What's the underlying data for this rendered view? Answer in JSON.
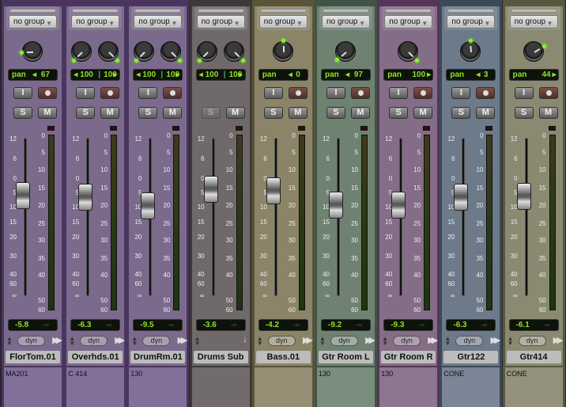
{
  "fader_scale": [
    "12",
    "6",
    "0",
    "5",
    "10",
    "15",
    "20",
    "30",
    "40",
    "60",
    "∞"
  ],
  "meter_scale": [
    "0",
    "5",
    "10",
    "15",
    "20",
    "25",
    "30",
    "35",
    "40",
    "50",
    "60"
  ],
  "volume_inf": "-∞",
  "channels": [
    {
      "name": "FlorTom.01",
      "group": "no group",
      "stereo": false,
      "pan_label": "pan",
      "pan": "67",
      "pan_dir": "left",
      "volume": "-5.8",
      "volume_db": -5.8,
      "comment": "MA201",
      "insert_label": "I",
      "solo": "S",
      "mute": "M",
      "dyn": "dyn",
      "color": "#7b6a8c",
      "border": "#4a3560",
      "comment_bg": "#82709a",
      "solo_disabled": false,
      "auxtype": false
    },
    {
      "name": "Overhds.01",
      "group": "no group",
      "stereo": true,
      "pan_l": "100",
      "pan_r": "100",
      "volume": "-6.3",
      "volume_db": -6.3,
      "comment": "C 414",
      "insert_label": "I",
      "solo": "S",
      "mute": "M",
      "dyn": "dyn",
      "color": "#7b6a8c",
      "border": "#4a3560",
      "comment_bg": "#82709a",
      "solo_disabled": false,
      "auxtype": false
    },
    {
      "name": "DrumRm.01",
      "group": "no group",
      "stereo": true,
      "pan_l": "100",
      "pan_r": "100",
      "volume": "-9.5",
      "volume_db": -9.5,
      "comment": "130",
      "insert_label": "I",
      "solo": "S",
      "mute": "M",
      "dyn": "dyn",
      "color": "#7b6a8c",
      "border": "#4a3560",
      "comment_bg": "#82709a",
      "solo_disabled": false,
      "auxtype": false
    },
    {
      "name": "Drums Sub",
      "group": "no group",
      "stereo": true,
      "pan_l": "100",
      "pan_r": "100",
      "volume": "-3.6",
      "volume_db": -3.6,
      "comment": "",
      "solo": "S",
      "mute": "M",
      "color": "#6f6a69",
      "border": "#3e3838",
      "comment_bg": "#716b6c",
      "solo_disabled": true,
      "auxtype": true
    },
    {
      "name": "Bass.01",
      "group": "no group",
      "stereo": false,
      "pan_label": "pan",
      "pan": "0",
      "pan_dir": "center",
      "volume": "-4.2",
      "volume_db": -4.2,
      "comment": "",
      "insert_label": "I",
      "solo": "S",
      "mute": "M",
      "dyn": "dyn",
      "color": "#8b8468",
      "border": "#5a5438",
      "comment_bg": "#958e74",
      "solo_disabled": false,
      "auxtype": false
    },
    {
      "name": "Gtr Room L",
      "group": "no group",
      "stereo": false,
      "pan_label": "pan",
      "pan": "97",
      "pan_dir": "left",
      "volume": "-9.2",
      "volume_db": -9.2,
      "comment": "130",
      "insert_label": "I",
      "solo": "S",
      "mute": "M",
      "dyn": "dyn",
      "color": "#6f8272",
      "border": "#3f5444",
      "comment_bg": "#7a8e7e",
      "solo_disabled": false,
      "auxtype": false
    },
    {
      "name": "Gtr Room R",
      "group": "no group",
      "stereo": false,
      "pan_label": "pan",
      "pan": "100",
      "pan_dir": "right",
      "volume": "-9.3",
      "volume_db": -9.3,
      "comment": "130",
      "insert_label": "I",
      "solo": "S",
      "mute": "M",
      "dyn": "dyn",
      "color": "#846d86",
      "border": "#553658",
      "comment_bg": "#8d7690",
      "solo_disabled": false,
      "auxtype": false
    },
    {
      "name": "Gtr122",
      "group": "no group",
      "stereo": false,
      "pan_label": "pan",
      "pan": "3",
      "pan_dir": "left",
      "volume": "-6.3",
      "volume_db": -6.3,
      "comment": "CONE",
      "insert_label": "I",
      "solo": "S",
      "mute": "M",
      "dyn": "dyn",
      "color": "#6c7a89",
      "border": "#3c4858",
      "comment_bg": "#7a8696",
      "solo_disabled": false,
      "auxtype": false
    },
    {
      "name": "Gtr414",
      "group": "no group",
      "stereo": false,
      "pan_label": "pan",
      "pan": "44",
      "pan_dir": "right",
      "volume": "-6.1",
      "volume_db": -6.1,
      "comment": "CONE",
      "insert_label": "I",
      "solo": "S",
      "mute": "M",
      "dyn": "dyn",
      "color": "#8a8a72",
      "border": "#58583e",
      "comment_bg": "#94927c",
      "solo_disabled": false,
      "auxtype": false
    }
  ]
}
